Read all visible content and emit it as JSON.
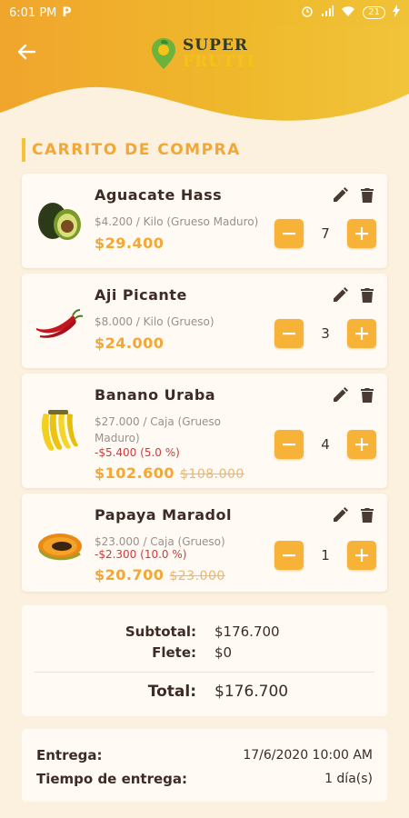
{
  "status_bar": {
    "time": "6:01 PM",
    "battery": "21"
  },
  "header": {
    "logo_line1": "SUPER",
    "logo_line2": "FRUTTI"
  },
  "cart": {
    "title": "CARRITO DE COMPRA",
    "items": [
      {
        "name": "Aguacate Hass",
        "unit_price": "$4.200 / Kilo (Grueso Maduro)",
        "discount": "",
        "price": "$29.400",
        "old_price": "",
        "quantity": "7"
      },
      {
        "name": "Aji Picante",
        "unit_price": "$8.000 / Kilo (Grueso)",
        "discount": "",
        "price": "$24.000",
        "old_price": "",
        "quantity": "3"
      },
      {
        "name": "Banano Uraba",
        "unit_price": "$27.000 / Caja (Grueso Maduro)",
        "discount": "-$5.400 (5.0 %)",
        "price": "$102.600",
        "old_price": "$108.000",
        "quantity": "4"
      },
      {
        "name": "Papaya Maradol",
        "unit_price": "$23.000 / Caja (Grueso)",
        "discount": "-$2.300 (10.0 %)",
        "price": "$20.700",
        "old_price": "$23.000",
        "quantity": "1"
      }
    ]
  },
  "totals": {
    "subtotal_label": "Subtotal:",
    "subtotal_value": "$176.700",
    "shipping_label": "Flete:",
    "shipping_value": "$0",
    "total_label": "Total:",
    "total_value": "$176.700"
  },
  "delivery": {
    "date_label": "Entrega:",
    "date_value": "17/6/2020 10:00 AM",
    "time_label": "Tiempo de entrega:",
    "time_value": "1 día(s)"
  },
  "colors": {
    "accent": "#f2a736",
    "button": "#f7b338",
    "discount": "#cf3b3b",
    "background": "#fbf1de"
  }
}
